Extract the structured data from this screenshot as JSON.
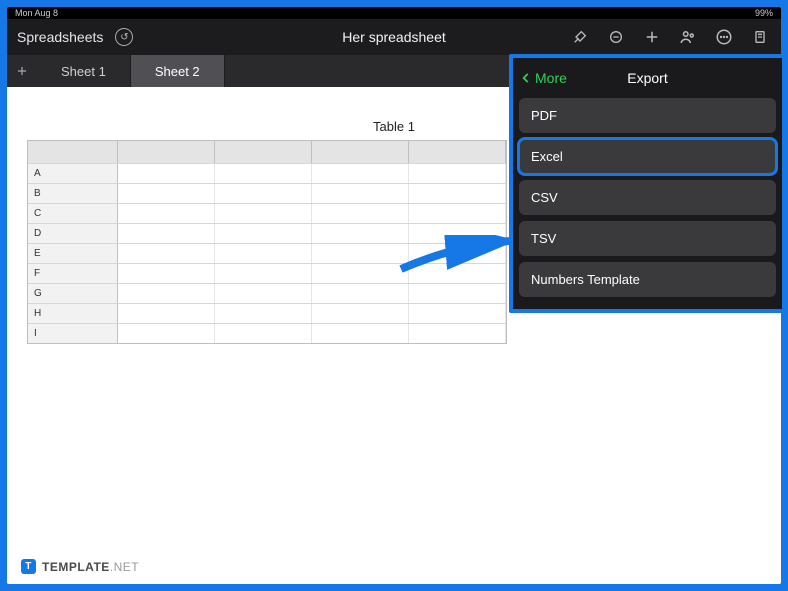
{
  "statusbar": {
    "left": "Mon Aug 8",
    "right": "99%"
  },
  "toolbar": {
    "back_label": "Spreadsheets",
    "title": "Her spreadsheet"
  },
  "tabs": {
    "items": [
      {
        "label": "Sheet 1",
        "active": false
      },
      {
        "label": "Sheet 2",
        "active": true
      }
    ]
  },
  "table": {
    "title": "Table 1",
    "rows": [
      "A",
      "B",
      "C",
      "D",
      "E",
      "F",
      "G",
      "H",
      "I"
    ]
  },
  "popover": {
    "back_label": "More",
    "title": "Export",
    "options": [
      {
        "label": "PDF",
        "highlight": false
      },
      {
        "label": "Excel",
        "highlight": true
      },
      {
        "label": "CSV",
        "highlight": false
      },
      {
        "label": "TSV",
        "highlight": false
      },
      {
        "label": "Numbers Template",
        "highlight": false
      }
    ]
  },
  "watermark": {
    "brand": "TEMPLATE",
    "suffix": ".NET"
  }
}
